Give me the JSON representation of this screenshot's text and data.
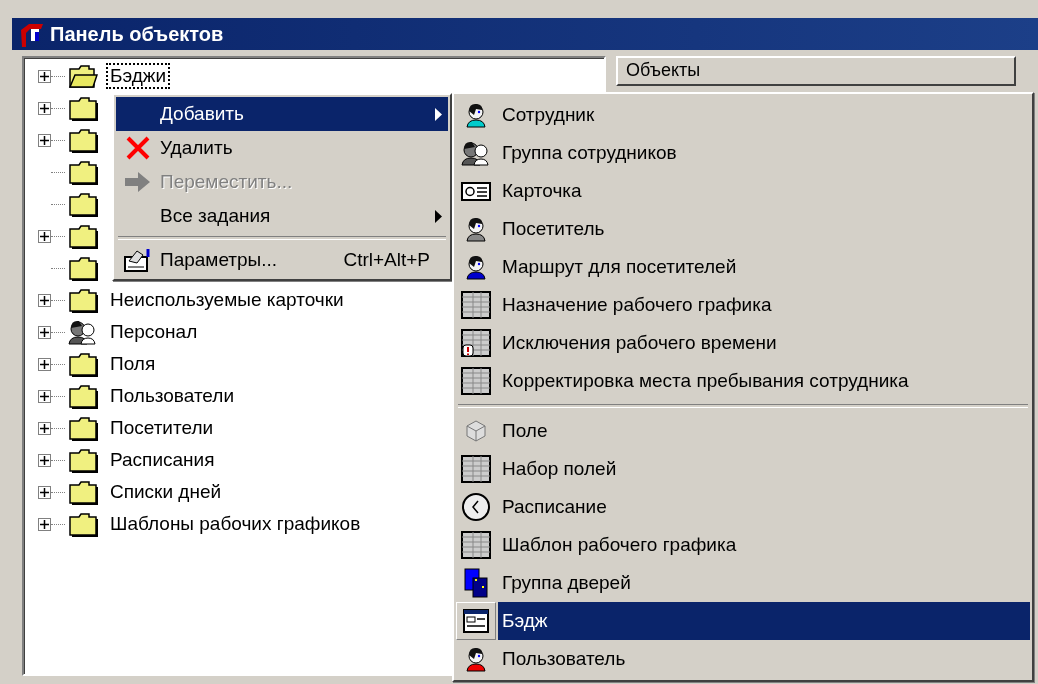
{
  "window": {
    "title": "Панель объектов"
  },
  "tree": {
    "items": [
      {
        "label": "Бэджи",
        "kind": "open-folder",
        "expandable": true,
        "selected": true
      },
      {
        "kind": "folder",
        "expandable": true,
        "selected": false
      },
      {
        "kind": "folder",
        "expandable": true,
        "selected": false
      },
      {
        "kind": "folder",
        "expandable": false,
        "selected": false
      },
      {
        "kind": "folder",
        "expandable": false,
        "selected": false
      },
      {
        "kind": "folder",
        "expandable": true,
        "selected": false
      },
      {
        "kind": "folder",
        "expandable": false,
        "selected": false
      },
      {
        "label": "Неиспользуемые карточки",
        "kind": "folder",
        "expandable": true,
        "selected": false
      },
      {
        "label": "Персонал",
        "kind": "group",
        "expandable": true,
        "selected": false
      },
      {
        "label": "Поля",
        "kind": "folder",
        "expandable": true,
        "selected": false
      },
      {
        "label": "Пользователи",
        "kind": "folder",
        "expandable": true,
        "selected": false
      },
      {
        "label": "Посетители",
        "kind": "folder",
        "expandable": true,
        "selected": false
      },
      {
        "label": "Расписания",
        "kind": "folder",
        "expandable": true,
        "selected": false
      },
      {
        "label": "Списки дней",
        "kind": "folder",
        "expandable": true,
        "selected": false
      },
      {
        "label": "Шаблоны рабочих графиков",
        "kind": "folder",
        "expandable": true,
        "selected": false
      }
    ]
  },
  "objects_panel": {
    "header": "Объекты"
  },
  "context_menu": {
    "items": [
      {
        "kind": "item",
        "label": "Добавить",
        "submenu": true,
        "selected": true,
        "disabled": false
      },
      {
        "kind": "item",
        "label": "Удалить",
        "submenu": false,
        "selected": false,
        "disabled": false
      },
      {
        "kind": "item",
        "label": "Переместить...",
        "submenu": false,
        "selected": false,
        "disabled": true
      },
      {
        "kind": "item",
        "label": "Все задания",
        "submenu": true,
        "selected": false,
        "disabled": false
      },
      {
        "kind": "separator"
      },
      {
        "kind": "item",
        "label": "Параметры...",
        "shortcut": "Ctrl+Alt+P",
        "submenu": false,
        "selected": false,
        "disabled": false
      }
    ]
  },
  "submenu": {
    "items": [
      {
        "kind": "item",
        "label": "Сотрудник",
        "selected": false
      },
      {
        "kind": "item",
        "label": "Группа сотрудников",
        "selected": false
      },
      {
        "kind": "item",
        "label": "Карточка",
        "selected": false
      },
      {
        "kind": "item",
        "label": "Посетитель",
        "selected": false
      },
      {
        "kind": "item",
        "label": "Маршрут для посетителей",
        "selected": false
      },
      {
        "kind": "item",
        "label": "Назначение рабочего графика",
        "selected": false
      },
      {
        "kind": "item",
        "label": "Исключения рабочего времени",
        "selected": false
      },
      {
        "kind": "item",
        "label": "Корректировка места пребывания сотрудника",
        "selected": false
      },
      {
        "kind": "separator"
      },
      {
        "kind": "item",
        "label": "Поле",
        "selected": false
      },
      {
        "kind": "item",
        "label": "Набор полей",
        "selected": false
      },
      {
        "kind": "item",
        "label": "Расписание",
        "selected": false
      },
      {
        "kind": "item",
        "label": "Шаблон рабочего графика",
        "selected": false
      },
      {
        "kind": "item",
        "label": "Группа дверей",
        "selected": false
      },
      {
        "kind": "item",
        "label": "Бэдж",
        "selected": true
      },
      {
        "kind": "item",
        "label": "Пользователь",
        "selected": false
      }
    ]
  }
}
